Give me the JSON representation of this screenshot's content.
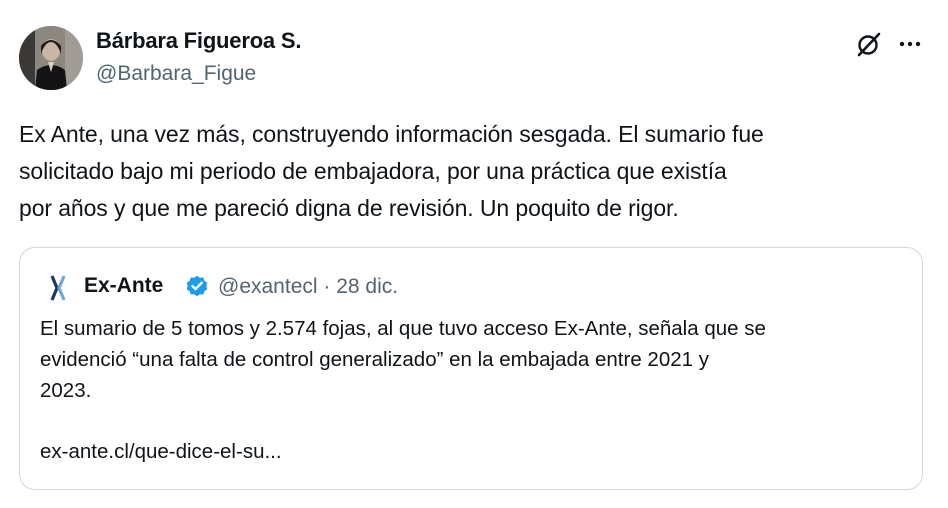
{
  "author": {
    "name": "Bárbara Figueroa S.",
    "handle": "@Barbara_Figue"
  },
  "icons": {
    "grok": "grok-icon",
    "more": "more-icon",
    "verified": "verified-badge-icon",
    "verified_color": "#1d9bf0"
  },
  "tweet": {
    "text_line_1": "Ex Ante, una vez más, construyendo información sesgada. El sumario fue",
    "text_line_2": "solicitado bajo mi periodo de embajadora, por una práctica que existía",
    "text_line_3": "por años y que me pareció digna de revisión. Un poquito de rigor."
  },
  "quote": {
    "name": "Ex-Ante",
    "handle": "@exantecl",
    "separator": " · ",
    "date": "28 dic.",
    "text_line_1": "El sumario de 5 tomos y 2.574 fojas, al que tuvo acceso Ex-Ante, señala que se",
    "text_line_2": "evidenció “una falta de control generalizado” en la embajada entre 2021 y",
    "text_line_3": "2023.",
    "link": "ex-ante.cl/que-dice-el-su..."
  },
  "colors": {
    "text": "#0f1419",
    "secondary": "#536471",
    "border": "#cfd9de",
    "verified": "#1d9bf0"
  }
}
